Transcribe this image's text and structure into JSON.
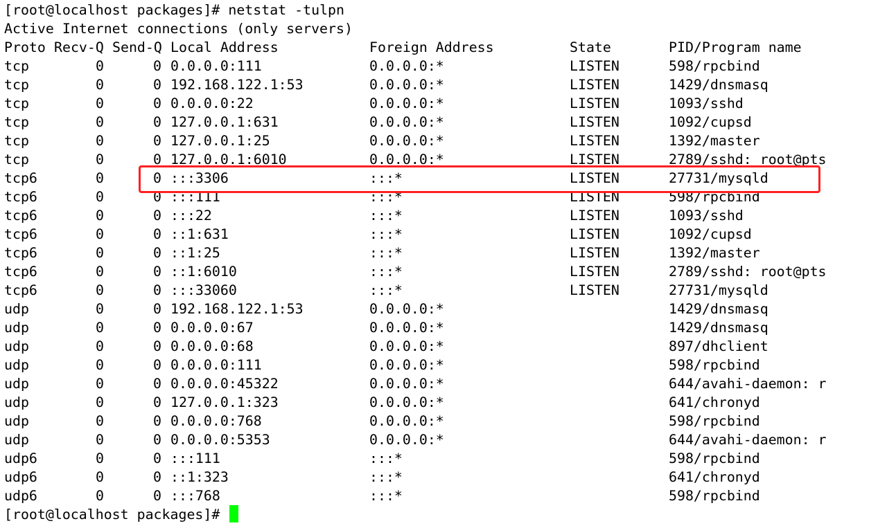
{
  "terminal": {
    "command_line": {
      "prompt": "[root@localhost packages]#",
      "command": "netstat -tulpn"
    },
    "banner": "Active Internet connections (only servers)",
    "headers": {
      "proto": "Proto",
      "recv_q": "Recv-Q",
      "send_q": "Send-Q",
      "local": "Local Address",
      "foreign": "Foreign Address",
      "state": "State",
      "pid": "PID/Program name"
    },
    "rows": [
      {
        "proto": "tcp",
        "recv_q": "0",
        "send_q": "0",
        "local": "0.0.0.0:111",
        "foreign": "0.0.0.0:*",
        "state": "LISTEN",
        "pid": "598/rpcbind"
      },
      {
        "proto": "tcp",
        "recv_q": "0",
        "send_q": "0",
        "local": "192.168.122.1:53",
        "foreign": "0.0.0.0:*",
        "state": "LISTEN",
        "pid": "1429/dnsmasq"
      },
      {
        "proto": "tcp",
        "recv_q": "0",
        "send_q": "0",
        "local": "0.0.0.0:22",
        "foreign": "0.0.0.0:*",
        "state": "LISTEN",
        "pid": "1093/sshd"
      },
      {
        "proto": "tcp",
        "recv_q": "0",
        "send_q": "0",
        "local": "127.0.0.1:631",
        "foreign": "0.0.0.0:*",
        "state": "LISTEN",
        "pid": "1092/cupsd"
      },
      {
        "proto": "tcp",
        "recv_q": "0",
        "send_q": "0",
        "local": "127.0.0.1:25",
        "foreign": "0.0.0.0:*",
        "state": "LISTEN",
        "pid": "1392/master"
      },
      {
        "proto": "tcp",
        "recv_q": "0",
        "send_q": "0",
        "local": "127.0.0.1:6010",
        "foreign": "0.0.0.0:*",
        "state": "LISTEN",
        "pid": "2789/sshd: root@pts"
      },
      {
        "proto": "tcp6",
        "recv_q": "0",
        "send_q": "0",
        "local": ":::3306",
        "foreign": ":::*",
        "state": "LISTEN",
        "pid": "27731/mysqld"
      },
      {
        "proto": "tcp6",
        "recv_q": "0",
        "send_q": "0",
        "local": ":::111",
        "foreign": ":::*",
        "state": "LISTEN",
        "pid": "598/rpcbind"
      },
      {
        "proto": "tcp6",
        "recv_q": "0",
        "send_q": "0",
        "local": ":::22",
        "foreign": ":::*",
        "state": "LISTEN",
        "pid": "1093/sshd"
      },
      {
        "proto": "tcp6",
        "recv_q": "0",
        "send_q": "0",
        "local": "::1:631",
        "foreign": ":::*",
        "state": "LISTEN",
        "pid": "1092/cupsd"
      },
      {
        "proto": "tcp6",
        "recv_q": "0",
        "send_q": "0",
        "local": "::1:25",
        "foreign": ":::*",
        "state": "LISTEN",
        "pid": "1392/master"
      },
      {
        "proto": "tcp6",
        "recv_q": "0",
        "send_q": "0",
        "local": "::1:6010",
        "foreign": ":::*",
        "state": "LISTEN",
        "pid": "2789/sshd: root@pts"
      },
      {
        "proto": "tcp6",
        "recv_q": "0",
        "send_q": "0",
        "local": ":::33060",
        "foreign": ":::*",
        "state": "LISTEN",
        "pid": "27731/mysqld"
      },
      {
        "proto": "udp",
        "recv_q": "0",
        "send_q": "0",
        "local": "192.168.122.1:53",
        "foreign": "0.0.0.0:*",
        "state": "",
        "pid": "1429/dnsmasq"
      },
      {
        "proto": "udp",
        "recv_q": "0",
        "send_q": "0",
        "local": "0.0.0.0:67",
        "foreign": "0.0.0.0:*",
        "state": "",
        "pid": "1429/dnsmasq"
      },
      {
        "proto": "udp",
        "recv_q": "0",
        "send_q": "0",
        "local": "0.0.0.0:68",
        "foreign": "0.0.0.0:*",
        "state": "",
        "pid": "897/dhclient"
      },
      {
        "proto": "udp",
        "recv_q": "0",
        "send_q": "0",
        "local": "0.0.0.0:111",
        "foreign": "0.0.0.0:*",
        "state": "",
        "pid": "598/rpcbind"
      },
      {
        "proto": "udp",
        "recv_q": "0",
        "send_q": "0",
        "local": "0.0.0.0:45322",
        "foreign": "0.0.0.0:*",
        "state": "",
        "pid": "644/avahi-daemon: r"
      },
      {
        "proto": "udp",
        "recv_q": "0",
        "send_q": "0",
        "local": "127.0.0.1:323",
        "foreign": "0.0.0.0:*",
        "state": "",
        "pid": "641/chronyd"
      },
      {
        "proto": "udp",
        "recv_q": "0",
        "send_q": "0",
        "local": "0.0.0.0:768",
        "foreign": "0.0.0.0:*",
        "state": "",
        "pid": "598/rpcbind"
      },
      {
        "proto": "udp",
        "recv_q": "0",
        "send_q": "0",
        "local": "0.0.0.0:5353",
        "foreign": "0.0.0.0:*",
        "state": "",
        "pid": "644/avahi-daemon: r"
      },
      {
        "proto": "udp6",
        "recv_q": "0",
        "send_q": "0",
        "local": ":::111",
        "foreign": ":::*",
        "state": "",
        "pid": "598/rpcbind"
      },
      {
        "proto": "udp6",
        "recv_q": "0",
        "send_q": "0",
        "local": "::1:323",
        "foreign": ":::*",
        "state": "",
        "pid": "641/chronyd"
      },
      {
        "proto": "udp6",
        "recv_q": "0",
        "send_q": "0",
        "local": ":::768",
        "foreign": ":::*",
        "state": "",
        "pid": "598/rpcbind"
      }
    ],
    "final_prompt": "[root@localhost packages]#",
    "highlighted_row_index": 6,
    "colors": {
      "background": "#ffffff",
      "text": "#000000",
      "cursor": "#00ff00",
      "highlight_border": "#ff2020"
    }
  }
}
